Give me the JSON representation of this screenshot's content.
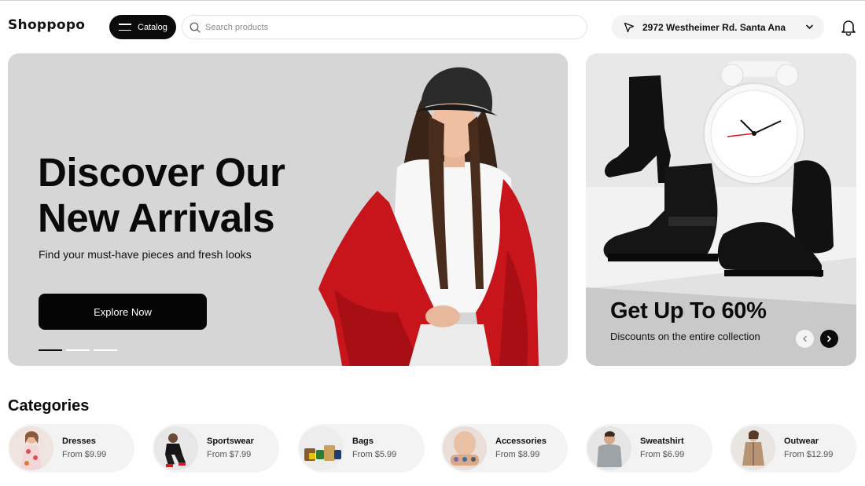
{
  "header": {
    "logo": "Shoppopo",
    "catalog_label": "Catalog",
    "search_placeholder": "Search products",
    "location": "2972 Westheimer Rd. Santa Ana"
  },
  "hero": {
    "title_line1": "Discover Our",
    "title_line2": "New Arrivals",
    "subtitle": "Find your must-have pieces and fresh looks",
    "cta_label": "Explore Now",
    "slides_total": 3,
    "slides_active": 1
  },
  "promo": {
    "title": "Get Up To 60%",
    "subtitle": "Discounts on the entire collection"
  },
  "categories": {
    "title": "Categories",
    "items": [
      {
        "name": "Dresses",
        "price": "From $9.99"
      },
      {
        "name": "Sportswear",
        "price": "From $7.99"
      },
      {
        "name": "Bags",
        "price": "From $5.99"
      },
      {
        "name": "Accessories",
        "price": "From $8.99"
      },
      {
        "name": "Sweatshirt",
        "price": "From $6.99"
      },
      {
        "name": "Outwear",
        "price": "From $12.99"
      }
    ]
  },
  "colors": {
    "primary": "#0b0b0b",
    "hero_bg": "#d6d6d6",
    "pill_bg": "#f3f3f3",
    "accent_red": "#c8141b"
  },
  "icons": [
    "menu-icon",
    "search-icon",
    "navigation-arrow-icon",
    "chevron-down-icon",
    "bell-icon",
    "chevron-left-icon",
    "chevron-right-icon"
  ]
}
